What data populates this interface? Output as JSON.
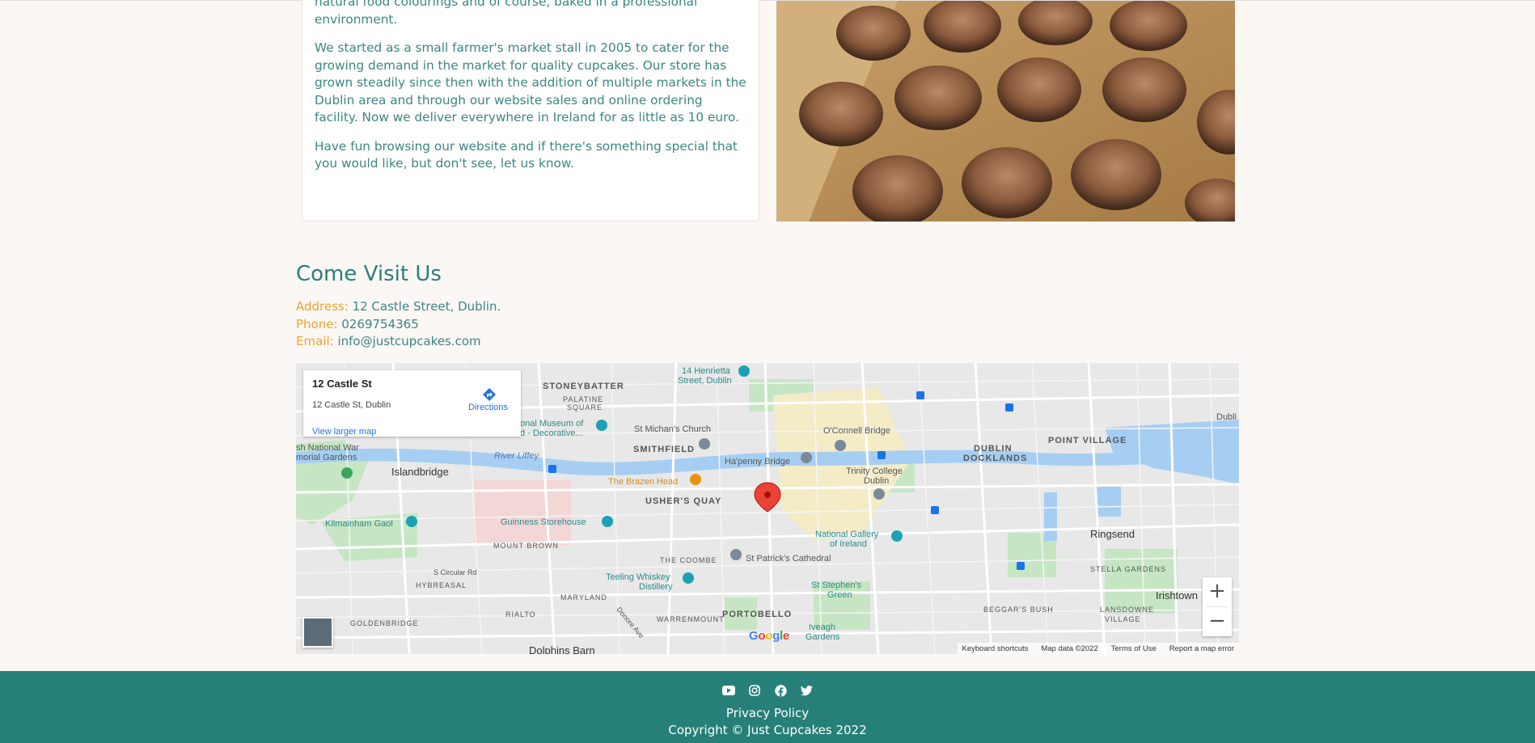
{
  "about": {
    "p0": "natural food colourings and of course, baked in a professional environment.",
    "p1": "We started as a small farmer's market stall in 2005 to cater for the growing demand in the market for quality cupcakes. Our store has grown steadily since then with the addition of multiple markets in the Dublin area and through our website sales and online ordering facility. Now we deliver everywhere in Ireland for as little as 10 euro.",
    "p2": "Have fun browsing our website and if there's something special that you would like, but don't see, let us know."
  },
  "visit": {
    "title": "Come Visit Us",
    "address_label": "Address:",
    "address": "12 Castle Street, Dublin.",
    "phone_label": "Phone:",
    "phone": "0269754365",
    "email_label": "Email:",
    "email": "info@justcupcakes.com"
  },
  "map": {
    "place_title": "12 Castle St",
    "place_address": "12 Castle St, Dublin",
    "directions": "Directions",
    "larger_map": "View larger map",
    "zoom_in": "+",
    "zoom_out": "−",
    "attrib": {
      "shortcuts": "Keyboard shortcuts",
      "data": "Map data ©2022",
      "terms": "Terms of Use",
      "report": "Report a map error"
    },
    "labels": {
      "stoneybatter": "STONEYBATTER",
      "palatine": "PALATINE",
      "square": "SQUARE",
      "henrietta1": "14 Henrietta",
      "henrietta2": "Street, Dublin",
      "museum1": "onal Museum of",
      "museum2": "d - Decorative...",
      "michans": "St Michan's Church",
      "smithfield": "SMITHFIELD",
      "connell": "O'Connell Bridge",
      "pointvillage": "POINT VILLAGE",
      "dublin": "Dubli",
      "docklands1": "DUBLIN",
      "docklands2": "DOCKLANDS",
      "nationalwar1": "sh National War",
      "nationalwar2": "morial Gardens",
      "islandbridge": "Islandbridge",
      "riverliffey": "River Liffey",
      "hapenny": "Ha'penny Bridge",
      "brazen": "The Brazen Head",
      "trinity1": "Trinity College",
      "trinity2": "Dublin",
      "usher": "USHER'S QUAY",
      "kilmainham": "Kilmainham Gaol",
      "guinness": "Guinness Storehouse",
      "mountbrown": "MOUNT BROWN",
      "gallery1": "National Gallery",
      "gallery2": "of Ireland",
      "ringsend": "Ringsend",
      "coombe": "THE COOMBE",
      "patricks": "St Patrick's Cathedral",
      "circular": "S Circular Rd",
      "hybreasal": "HYBREASAL",
      "teeling1": "Teeling Whiskey",
      "teeling2": "Distillery",
      "stephens1": "St Stephen's",
      "stephens2": "Green",
      "stella": "STELLA GARDENS",
      "irishtown": "Irishtown",
      "goldenbridge": "GOLDENBRIDGE",
      "maryland": "MARYLAND",
      "rialto": "RIALTO",
      "warrenmount": "WARRENMOUNT",
      "portobello": "PORTOBELLO",
      "beggars": "BEGGAR'S BUSH",
      "lansdowne1": "LANSDOWNE",
      "lansdowne2": "VILLAGE",
      "iveagh1": "Iveagh",
      "iveagh2": "Gardens",
      "dolphins": "Dolphins Barn",
      "donore": "Donore Ave"
    }
  },
  "footer": {
    "privacy": "Privacy Policy",
    "copyright": "Copyright © Just Cupcakes 2022"
  },
  "colors": {
    "teal": "#267f78",
    "accent": "#f0a22e",
    "text": "#3b8781",
    "background": "#fbf7f5"
  },
  "icons": [
    "youtube-icon",
    "instagram-icon",
    "facebook-icon",
    "twitter-icon",
    "directions-icon",
    "map-pin-icon"
  ]
}
